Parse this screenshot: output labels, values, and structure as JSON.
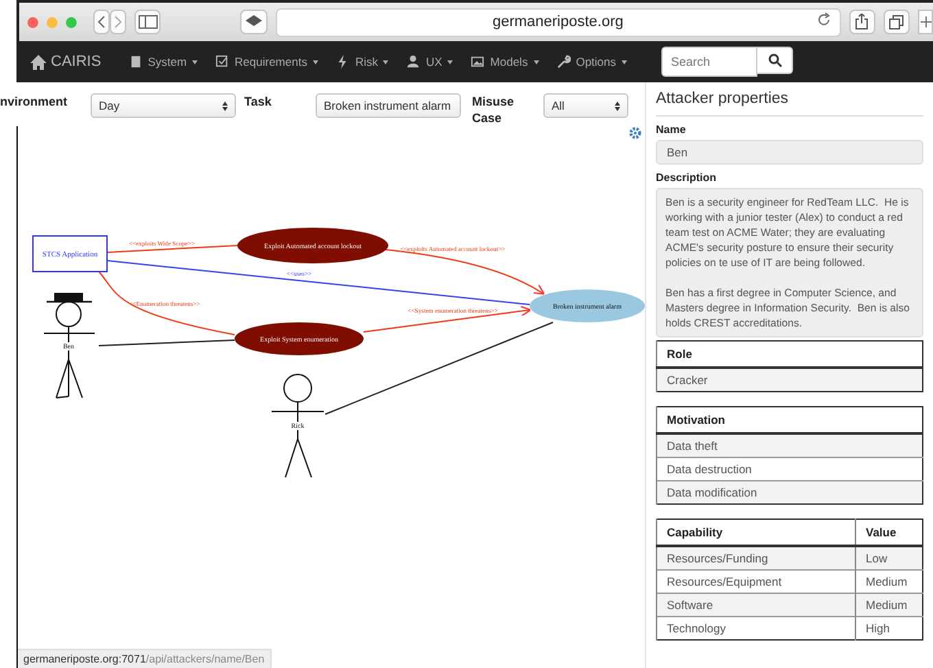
{
  "browser": {
    "address": "germaneriposte.org"
  },
  "navbar": {
    "brand": "CAIRIS",
    "menus": [
      {
        "label": "System"
      },
      {
        "label": "Requirements"
      },
      {
        "label": "Risk"
      },
      {
        "label": "UX"
      },
      {
        "label": "Models"
      },
      {
        "label": "Options"
      }
    ],
    "search": {
      "placeholder": "Search"
    }
  },
  "filters": [
    {
      "label": "nvironment",
      "value": "Day"
    },
    {
      "label": "Task",
      "value": "Broken instrument alarm"
    },
    {
      "label": "Misuse Case",
      "value": "All"
    }
  ],
  "diagram": {
    "nodes": [
      {
        "kind": "asset",
        "label": "STCS Application"
      },
      {
        "kind": "misuse_case",
        "label": "Exploit Automated account lockout"
      },
      {
        "kind": "misuse_case",
        "label": "Exploit System enumeration"
      },
      {
        "kind": "task",
        "label": "Broken instrument alarm"
      },
      {
        "kind": "attacker",
        "label": "Ben"
      },
      {
        "kind": "persona",
        "label": "Rick"
      }
    ],
    "edges": [
      {
        "kind": "threat",
        "label": "<<exploits Wide Scope>>"
      },
      {
        "kind": "threat",
        "label": "<<exploits Automated account lockout>>"
      },
      {
        "kind": "uses",
        "label": "<<uses>>"
      },
      {
        "kind": "threat",
        "label": "<<Enumeration threatens>>"
      },
      {
        "kind": "threat",
        "label": "<<System enumeration threatens>>"
      },
      {
        "kind": "association"
      },
      {
        "kind": "association"
      }
    ]
  },
  "attacker_properties": {
    "title": "Attacker properties",
    "name": {
      "label": "Name",
      "value": "Ben"
    },
    "description": {
      "label": "Description",
      "value": "Ben is a security engineer for RedTeam LLC.  He is working with a junior tester (Alex) to conduct a red team test on ACME Water; they are evaluating ACME's security posture to ensure their security policies on te use of IT are being followed.\n\nBen has a first degree in Computer Science, and Masters degree in Information Security.  Ben is also holds CREST accreditations."
    },
    "role": {
      "columns": [
        "Role"
      ],
      "rows": [
        [
          "Cracker"
        ]
      ]
    },
    "motivation": {
      "columns": [
        "Motivation"
      ],
      "rows": [
        [
          "Data theft"
        ],
        [
          "Data destruction"
        ],
        [
          "Data modification"
        ]
      ]
    },
    "capability": {
      "columns": [
        "Capability",
        "Value"
      ],
      "rows": [
        [
          "Resources/Funding",
          "Low"
        ],
        [
          "Resources/Equipment",
          "Medium"
        ],
        [
          "Software",
          "Medium"
        ],
        [
          "Technology",
          "High"
        ]
      ]
    }
  },
  "status_bar": {
    "url": "**germaneriposte.org:7071**/api/attackers/name/Ben"
  }
}
